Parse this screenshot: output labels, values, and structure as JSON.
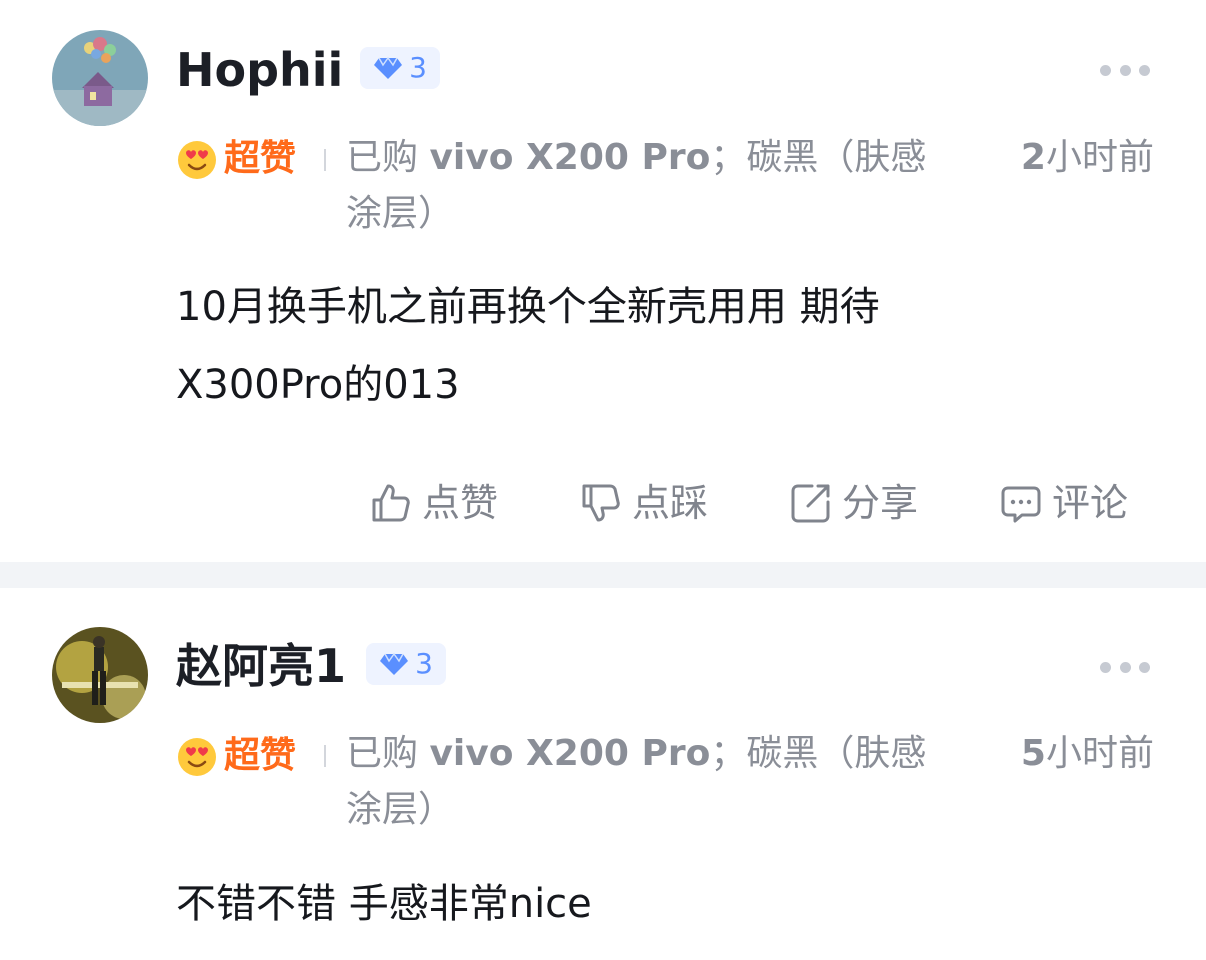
{
  "reviews": [
    {
      "username": "Hophii",
      "level": "3",
      "rating_label": "超赞",
      "purchase_prefix": "已购",
      "purchase_model": "vivo X200 Pro",
      "purchase_variant": "；碳黑（肤感涂层）",
      "time_num": "2",
      "time_unit": "小时前",
      "content_line1": "10月换手机之前再换个全新壳用用 期待",
      "content_line2": "X300Pro的013"
    },
    {
      "username": "赵阿亮1",
      "level": "3",
      "rating_label": "超赞",
      "purchase_prefix": "已购",
      "purchase_model": "vivo X200 Pro",
      "purchase_variant": "；碳黑（肤感涂层）",
      "time_num": "5",
      "time_unit": "小时前",
      "content_line1": "不错不错 手感非常nice"
    }
  ],
  "actions": {
    "like": "点赞",
    "dislike": "点踩",
    "share": "分享",
    "comment": "评论"
  },
  "colors": {
    "accent_rating": "#ff6a1a",
    "level_badge": "#5a8fff",
    "meta_text": "#8a8e97"
  },
  "icons": [
    "diamond-icon",
    "heart-eyes-emoji-icon",
    "more-dots-icon",
    "thumbs-up-icon",
    "thumbs-down-icon",
    "share-icon",
    "comment-icon"
  ]
}
